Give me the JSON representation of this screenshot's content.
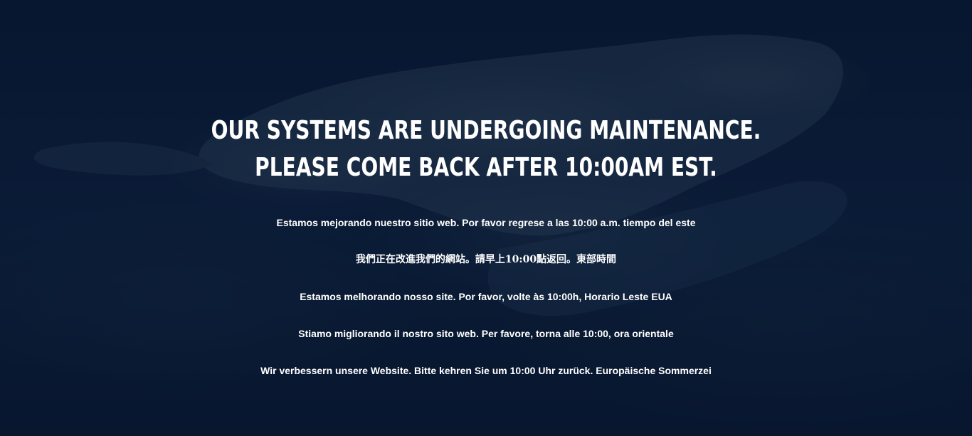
{
  "background": {
    "description_icon": "aerial-island-photo",
    "overlay_color": "#0c1b33"
  },
  "headline": {
    "line1": "OUR SYSTEMS ARE UNDERGOING MAINTENANCE.",
    "line2": "PLEASE COME BACK AFTER 10:00AM EST."
  },
  "messages": {
    "spanish": "Estamos mejorando nuestro sitio web. Por favor regrese a las 10:00 a.m. tiempo del este",
    "chinese": "我們正在改進我們的網站。請早上10:00點返回。東部時間",
    "portuguese": "Estamos melhorando nosso site. Por favor, volte às 10:00h, Horario Leste EUA",
    "italian": "Stiamo migliorando il nostro sito web. Per favore, torna alle 10:00, ora orientale",
    "german": "Wir verbessern unsere Website. Bitte kehren Sie um 10:00 Uhr zurück. Europäische Sommerzei"
  }
}
